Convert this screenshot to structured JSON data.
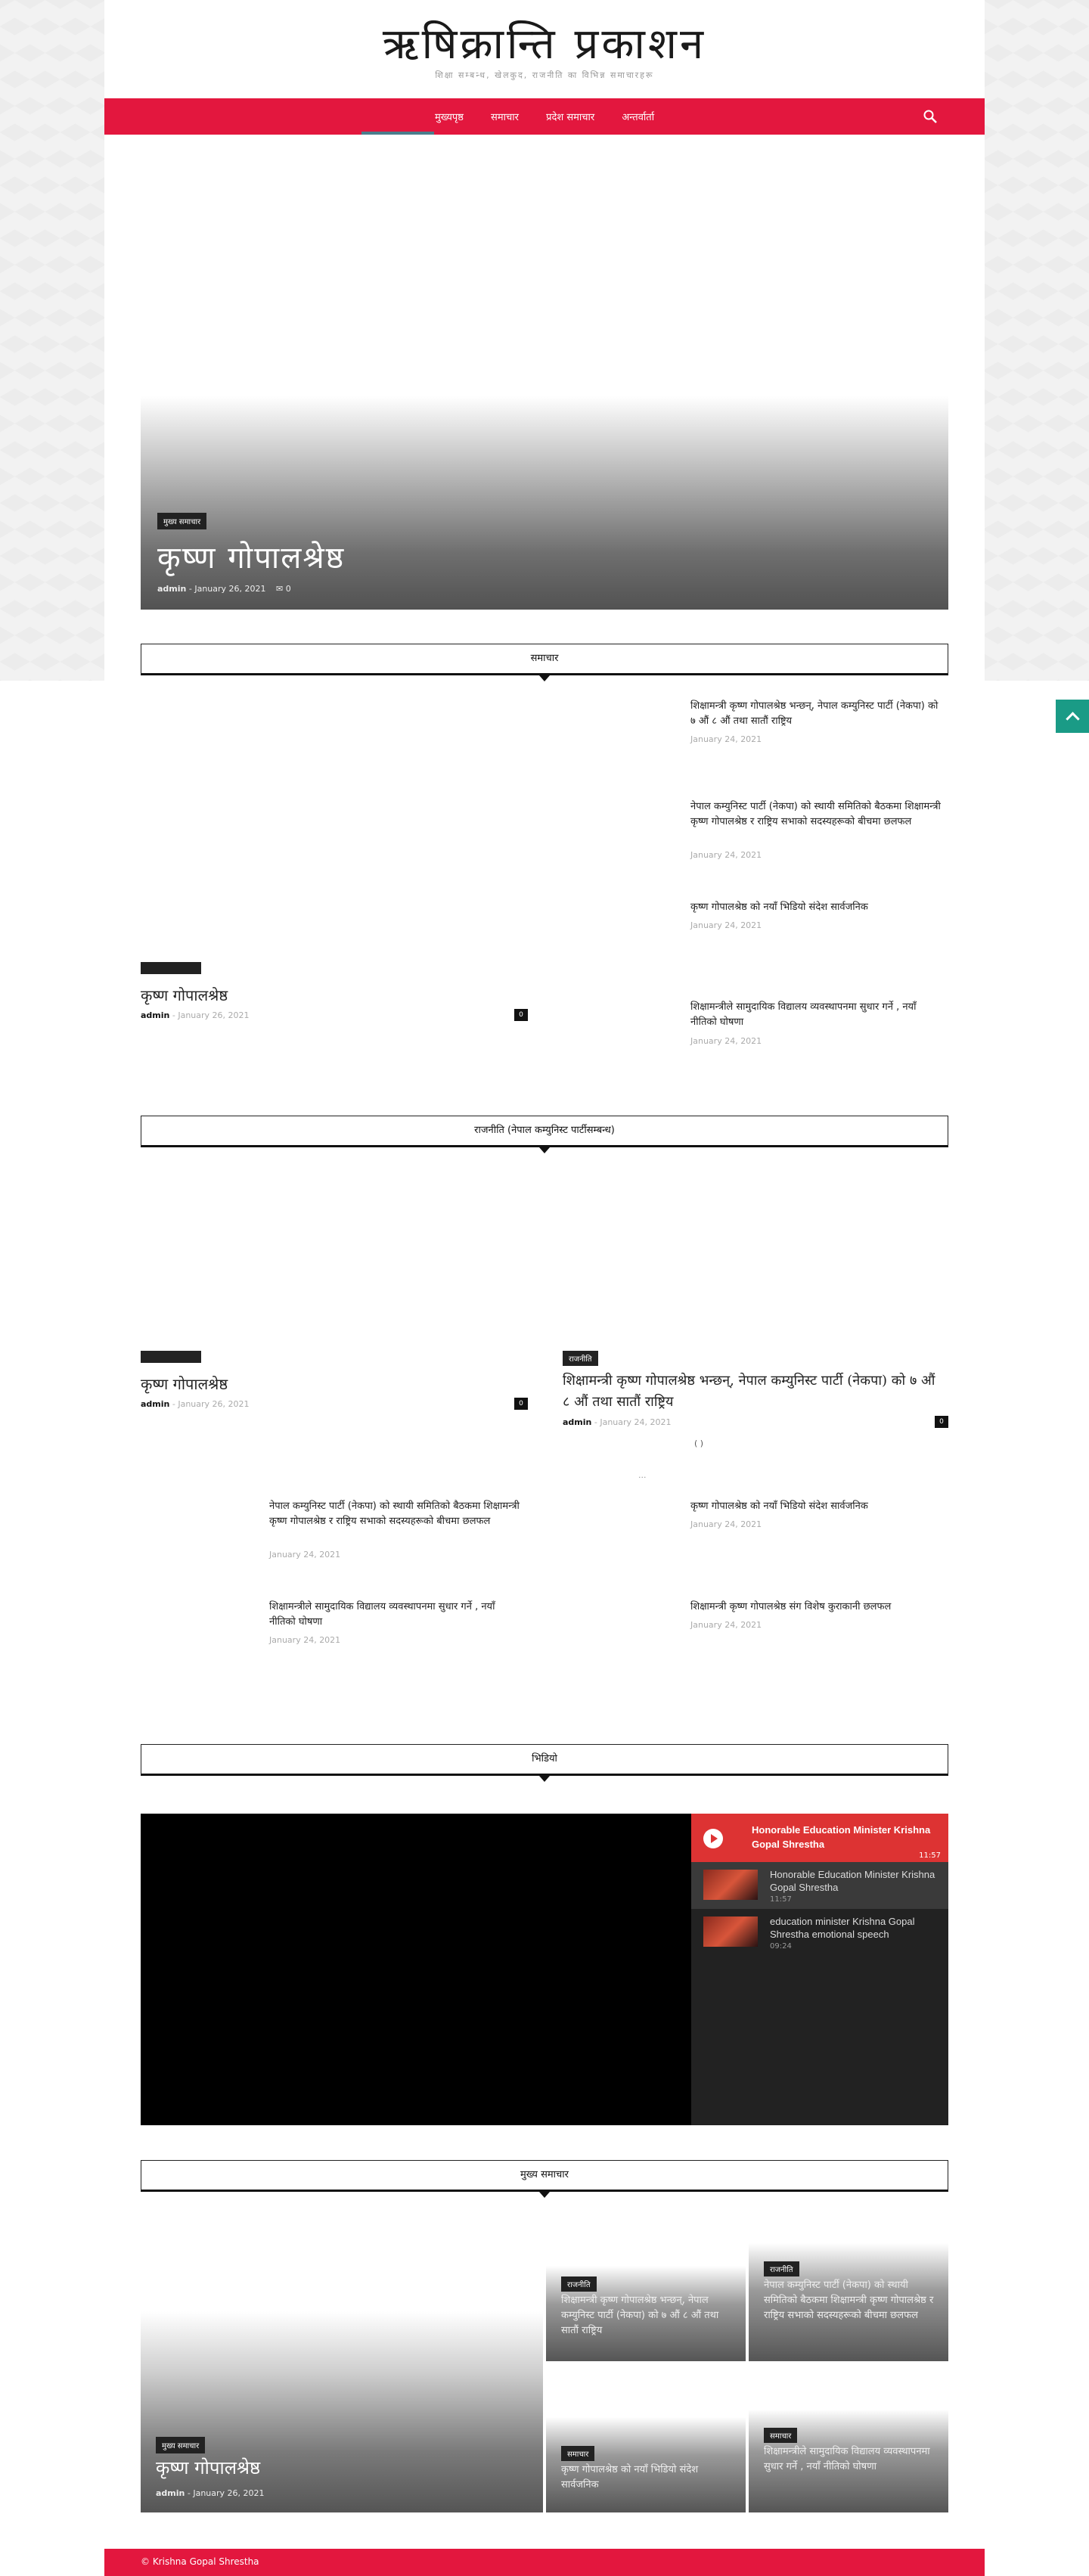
{
  "site": {
    "title": "ऋषिक्रान्ति प्रकाशन",
    "tagline": "शिक्षा सम्बन्ध, खेलकुद, राजनीति का विभिन्न समाचारहरू"
  },
  "colors": {
    "accent": "#e3173e",
    "nav_indicator": "#4b7d8c",
    "video_accent": "#dd3333",
    "to_top": "#1a9b86"
  },
  "nav": {
    "items": [
      "मुख्यपृष्ठ",
      "समाचार",
      "प्रदेश समाचार",
      "अन्तर्वार्ता"
    ],
    "search_icon": "search-icon"
  },
  "hero": {
    "category": "मुख्य समाचार",
    "title": "कृष्ण गोपालश्रेष्ठ",
    "author": "admin",
    "date": "January 26, 2021",
    "comments": "0"
  },
  "section1": {
    "heading": "समाचार",
    "featured": {
      "title": "कृष्ण गोपालश्रेष्ठ",
      "author": "admin",
      "date": "January 26, 2021",
      "comments": "0"
    },
    "list": [
      {
        "title": "शिक्षामन्त्री कृष्ण गोपालश्रेष्ठ भन्छन्, नेपाल कम्युनिस्ट पार्टी (नेकपा) को ७ औं ८ औं तथा सातौं राष्ट्रिय",
        "date": "January 24, 2021"
      },
      {
        "title": "नेपाल कम्युनिस्ट पार्टी (नेकपा) को स्थायी समितिको बैठकमा शिक्षामन्त्री कृष्ण गोपालश्रेष्ठ र राष्ट्रिय सभाको सदस्यहरूको बीचमा छलफल",
        "date": "January 24, 2021"
      },
      {
        "title": "कृष्ण गोपालश्रेष्ठ को नयाँ भिडियो संदेश सार्वजनिक",
        "date": "January 24, 2021"
      },
      {
        "title": "शिक्षामन्त्रीले सामुदायिक विद्यालय व्यवस्थापनमा सुधार गर्ने , नयाँ नीतिको घोषणा",
        "date": "January 24, 2021"
      }
    ]
  },
  "section2": {
    "heading": "राजनीति (नेपाल कम्युनिस्ट पार्टीसम्बन्ध)",
    "left": {
      "title": "कृष्ण गोपालश्रेष्ठ",
      "author": "admin",
      "date": "January 26, 2021",
      "comments": "0"
    },
    "right": {
      "category": "राजनीति",
      "title": "शिक्षामन्त्री कृष्ण गोपालश्रेष्ठ भन्छन्, नेपाल कम्युनिस्ट पार्टी (नेकपा) को ७ औं ८ औं तथा सातौं राष्ट्रिय",
      "author": "admin",
      "date": "January 24, 2021",
      "comments": "0"
    },
    "pager": "(      )",
    "pager_dots": "...",
    "list": [
      {
        "title": "नेपाल कम्युनिस्ट पार्टी (नेकपा) को स्थायी समितिको बैठकमा शिक्षामन्त्री कृष्ण गोपालश्रेष्ठ र राष्ट्रिय सभाको सदस्यहरूको बीचमा छलफल",
        "date": "January 24, 2021"
      },
      {
        "title": "कृष्ण गोपालश्रेष्ठ को नयाँ भिडियो संदेश सार्वजनिक",
        "date": "January 24, 2021"
      },
      {
        "title": "शिक्षामन्त्रीले सामुदायिक विद्यालय व्यवस्थापनमा सुधार गर्ने , नयाँ नीतिको घोषणा",
        "date": "January 24, 2021"
      },
      {
        "title": "शिक्षामन्त्री कृष्ण गोपालश्रेष्ठ संग विशेष कुराकानी छलफल",
        "date": "January 24, 2021"
      }
    ]
  },
  "section3": {
    "heading": "भिडियो",
    "playing": {
      "title": "Honorable Education Minister Krishna Gopal Shrestha",
      "duration": "11:57"
    },
    "playlist": [
      {
        "title": "Honorable Education Minister Krishna Gopal Shrestha",
        "duration": "11:57"
      },
      {
        "title": "education minister Krishna Gopal Shrestha emotional speech",
        "duration": "09:24"
      }
    ]
  },
  "section4": {
    "heading": "मुख्य समाचार",
    "big": {
      "category": "मुख्य समाचार",
      "title": "कृष्ण गोपालश्रेष्ठ",
      "author": "admin",
      "date": "January 26, 2021"
    },
    "tiles": [
      {
        "category": "राजनीति",
        "title": "शिक्षामन्त्री कृष्ण गोपालश्रेष्ठ भन्छन्, नेपाल कम्युनिस्ट पार्टी (नेकपा) को ७ औं ८ औं तथा सातौं राष्ट्रिय"
      },
      {
        "category": "राजनीति",
        "title": "नेपाल कम्युनिस्ट पार्टी (नेकपा) को स्थायी समितिको बैठकमा शिक्षामन्त्री कृष्ण गोपालश्रेष्ठ र राष्ट्रिय सभाको सदस्यहरूको बीचमा छलफल"
      },
      {
        "category": "समाचार",
        "title": "कृष्ण गोपालश्रेष्ठ को नयाँ भिडियो संदेश सार्वजनिक"
      },
      {
        "category": "समाचार",
        "title": "शिक्षामन्त्रीले सामुदायिक विद्यालय व्यवस्थापनमा सुधार गर्ने , नयाँ नीतिको घोषणा"
      }
    ]
  },
  "footer": {
    "copyright": "© Krishna Gopal Shrestha"
  }
}
